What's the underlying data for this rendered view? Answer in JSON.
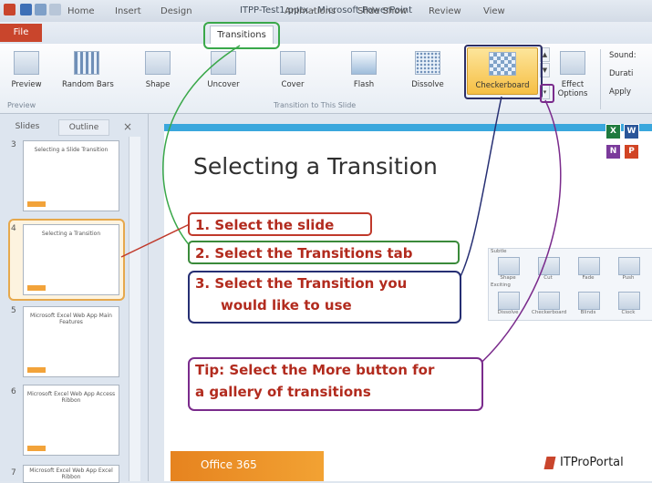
{
  "window": {
    "title": "ITPP-Test1.pptx - Microsoft PowerPoint"
  },
  "ribbon_tabs": [
    "File",
    "Home",
    "Insert",
    "Design",
    "Transitions",
    "Animations",
    "Slide Show",
    "Review",
    "View"
  ],
  "ribbon": {
    "preview_label": "Preview",
    "preview_group": "Preview",
    "transitions": [
      "Random Bars",
      "Shape",
      "Uncover",
      "Cover",
      "Flash",
      "Dissolve"
    ],
    "selected_transition": "Checkerboard",
    "effect_options": "Effect Options",
    "group_label": "Transition to This Slide",
    "timing": [
      "Sound:",
      "Durati",
      "Apply"
    ]
  },
  "panel": {
    "tabs": [
      "Slides",
      "Outline"
    ],
    "close": "×",
    "slide_numbers": [
      "3",
      "4",
      "5",
      "6",
      "7"
    ],
    "thumb_titles": [
      "Selecting a Slide Transition",
      "Selecting a Transition",
      "Microsoft Excel Web App Main Features",
      "Microsoft Excel Web App Access Ribbon",
      "Microsoft Excel Web App Excel Ribbon"
    ]
  },
  "slide": {
    "title": "Selecting a Transition",
    "office_brand": "Office 365",
    "site_brand": "ITProPortal",
    "app_icons": [
      "X",
      "W",
      "N",
      "P"
    ]
  },
  "gallery": {
    "row1": [
      "Shape",
      "Cut",
      "Fade",
      "Push"
    ],
    "row2": [
      "Dissolve",
      "Checkerboard",
      "Blinds",
      "Clock"
    ],
    "headers": [
      "Subtle",
      "Exciting"
    ]
  },
  "annotations": {
    "step1": "1.  Select the slide",
    "step2": "2.  Select the Transitions tab",
    "step3_line1": "3.  Select the Transition you",
    "step3_line2": "would like to use",
    "tip_line1": "Tip: Select the More button for",
    "tip_line2": "a gallery of transitions"
  },
  "colors": {
    "accent": "#3aa7dd",
    "file_tab": "#c9452c",
    "annotation_text": "#b22b1e",
    "office": "#f2a233"
  }
}
